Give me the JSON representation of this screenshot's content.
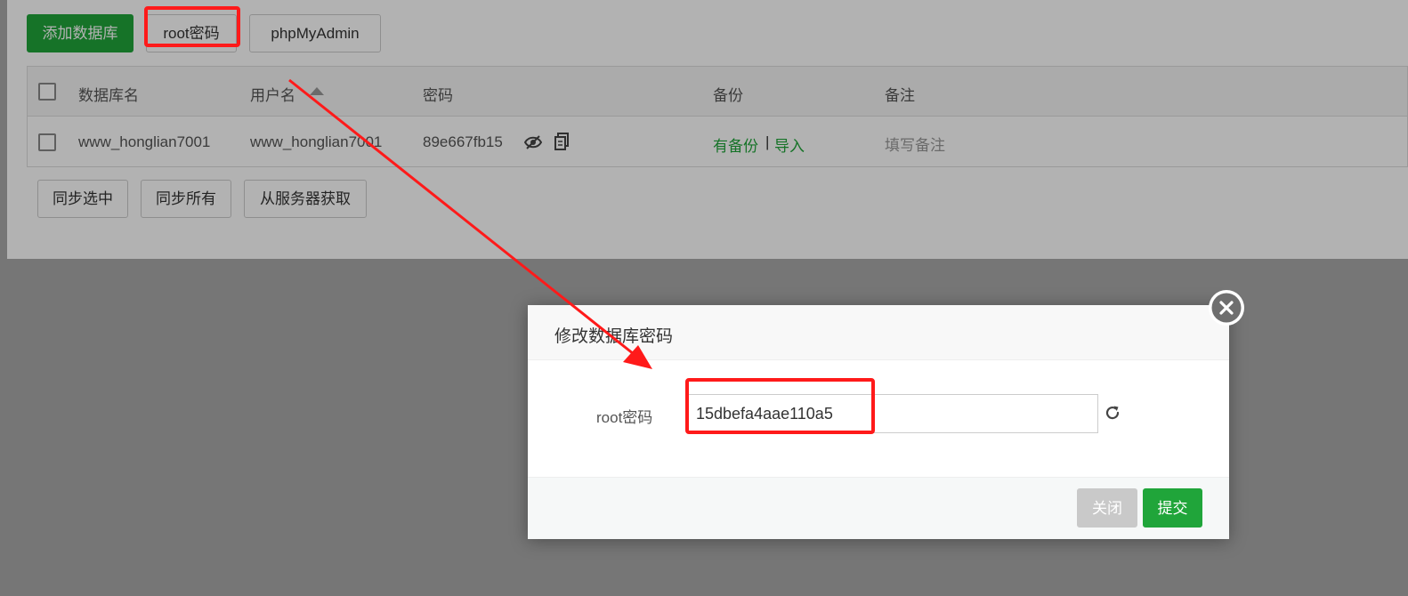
{
  "toolbar": {
    "add_db_label": "添加数据库",
    "root_pwd_label": "root密码",
    "phpmyadmin_label": "phpMyAdmin"
  },
  "table": {
    "columns": [
      "数据库名",
      "用户名",
      "密码",
      "备份",
      "备注"
    ],
    "rows": [
      {
        "db_name": "www_honglian7001",
        "username": "www_honglian7001",
        "password": "89e667fb15",
        "backup": "有备份",
        "separator": "|",
        "import": "导入",
        "note": "填写备注"
      }
    ]
  },
  "bottom_actions": {
    "sync_selected": "同步选中",
    "sync_all": "同步所有",
    "fetch_server": "从服务器获取"
  },
  "modal": {
    "title": "修改数据库密码",
    "field_label": "root密码",
    "field_value": "15dbefa4aae110a5",
    "close_label": "关闭",
    "submit_label": "提交"
  },
  "colors": {
    "accent_green": "#20a53a",
    "annotation_red": "#ff1a1a"
  }
}
